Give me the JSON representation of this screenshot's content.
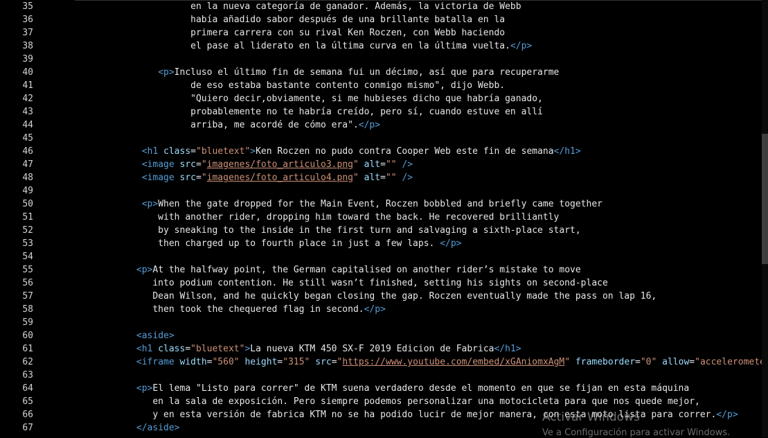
{
  "editor": {
    "first_line_number": 35,
    "lines": [
      [
        [
          "text",
          "                            en la nueva categoría de ganador. Además, la victoria de Webb"
        ]
      ],
      [
        [
          "text",
          "                            había añadido sabor después de una brillante batalla en la"
        ]
      ],
      [
        [
          "text",
          "                            primera carrera con su rival Ken Roczen, con Webb haciendo"
        ]
      ],
      [
        [
          "text",
          "                            el pase al liderato en la última curva en la última vuelta."
        ],
        [
          "tag",
          "</p>"
        ]
      ],
      [],
      [
        [
          "text",
          "                      "
        ],
        [
          "tag",
          "<p>"
        ],
        [
          "text",
          "Incluso el último fin de semana fui un décimo, así que para recuperarme"
        ]
      ],
      [
        [
          "text",
          "                            de eso estaba bastante contento conmigo mismo\", dijo Webb."
        ]
      ],
      [
        [
          "text",
          "                            \"Quiero decir,obviamente, si me hubieses dicho que habría ganado,"
        ]
      ],
      [
        [
          "text",
          "                            probablemente no te habría creído, pero sí, cuando estuve en allí"
        ]
      ],
      [
        [
          "text",
          "                            arriba, me acordé de cómo era\"."
        ],
        [
          "tag",
          "</p>"
        ]
      ],
      [],
      [
        [
          "text",
          "                   "
        ],
        [
          "tag",
          "<h1 "
        ],
        [
          "attr",
          "class"
        ],
        [
          "text",
          "="
        ],
        [
          "str",
          "\"bluetext\""
        ],
        [
          "tag",
          ">"
        ],
        [
          "text",
          "Ken Roczen no pudo contra Cooper Web este fin de semana"
        ],
        [
          "tag",
          "</h1>"
        ]
      ],
      [
        [
          "text",
          "                   "
        ],
        [
          "tag",
          "<image "
        ],
        [
          "attr",
          "src"
        ],
        [
          "text",
          "="
        ],
        [
          "str",
          "\""
        ],
        [
          "url",
          "imagenes/foto_articulo3.png"
        ],
        [
          "str",
          "\""
        ],
        [
          "text",
          " "
        ],
        [
          "attr",
          "alt"
        ],
        [
          "text",
          "="
        ],
        [
          "str",
          "\"\""
        ],
        [
          "text",
          " "
        ],
        [
          "tag",
          "/>"
        ]
      ],
      [
        [
          "text",
          "                   "
        ],
        [
          "tag",
          "<image "
        ],
        [
          "attr",
          "src"
        ],
        [
          "text",
          "="
        ],
        [
          "str",
          "\""
        ],
        [
          "url",
          "imagenes/foto_articulo4.png"
        ],
        [
          "str",
          "\""
        ],
        [
          "text",
          " "
        ],
        [
          "attr",
          "alt"
        ],
        [
          "text",
          "="
        ],
        [
          "str",
          "\"\""
        ],
        [
          "text",
          " "
        ],
        [
          "tag",
          "/>"
        ]
      ],
      [],
      [
        [
          "text",
          "                   "
        ],
        [
          "tag",
          "<p>"
        ],
        [
          "text",
          "When the gate dropped for the Main Event, Roczen bobbled and briefly came together"
        ]
      ],
      [
        [
          "text",
          "                      with another rider, dropping him toward the back. He recovered brilliantly"
        ]
      ],
      [
        [
          "text",
          "                      by sneaking to the inside in the first turn and salvaging a sixth-place start,"
        ]
      ],
      [
        [
          "text",
          "                      then charged up to fourth place in just a few laps. "
        ],
        [
          "tag",
          "</p>"
        ]
      ],
      [],
      [
        [
          "text",
          "                  "
        ],
        [
          "tag",
          "<p>"
        ],
        [
          "text",
          "At the halfway point, the German capitalised on another rider’s mistake to move"
        ]
      ],
      [
        [
          "text",
          "                     into podium contention. He still wasn’t finished, setting his sights on second-place"
        ]
      ],
      [
        [
          "text",
          "                     Dean Wilson, and he quickly began closing the gap. Roczen eventually made the pass on lap 16,"
        ]
      ],
      [
        [
          "text",
          "                     then took the chequered flag in second."
        ],
        [
          "tag",
          "</p>"
        ]
      ],
      [],
      [
        [
          "text",
          "                  "
        ],
        [
          "tag",
          "<aside>"
        ]
      ],
      [
        [
          "text",
          "                  "
        ],
        [
          "tag",
          "<h1 "
        ],
        [
          "attr",
          "class"
        ],
        [
          "text",
          "="
        ],
        [
          "str",
          "\"bluetext\""
        ],
        [
          "tag",
          ">"
        ],
        [
          "text",
          "La nueva KTM 450 SX-F 2019 Edicion de Fabrica"
        ],
        [
          "tag",
          "</h1>"
        ]
      ],
      [
        [
          "text",
          "                  "
        ],
        [
          "tag",
          "<iframe "
        ],
        [
          "attr",
          "width"
        ],
        [
          "text",
          "="
        ],
        [
          "str",
          "\"560\""
        ],
        [
          "text",
          " "
        ],
        [
          "attr",
          "height"
        ],
        [
          "text",
          "="
        ],
        [
          "str",
          "\"315\""
        ],
        [
          "text",
          " "
        ],
        [
          "attr",
          "src"
        ],
        [
          "text",
          "="
        ],
        [
          "str",
          "\""
        ],
        [
          "url",
          "https://www.youtube.com/embed/xGAniomxAgM"
        ],
        [
          "str",
          "\""
        ],
        [
          "text",
          " "
        ],
        [
          "attr",
          "frameborder"
        ],
        [
          "text",
          "="
        ],
        [
          "str",
          "\"0\""
        ],
        [
          "text",
          " "
        ],
        [
          "attr",
          "allow"
        ],
        [
          "text",
          "="
        ],
        [
          "str",
          "\"accelerometer;"
        ]
      ],
      [],
      [
        [
          "text",
          "                  "
        ],
        [
          "tag",
          "<p>"
        ],
        [
          "text",
          "El lema \"Listo para correr\" de KTM suena verdadero desde el momento en que se fijan en esta máquina"
        ]
      ],
      [
        [
          "text",
          "                     en la sala de exposición. Pero siempre podemos personalizar una motocicleta para que nos quede mejor,"
        ]
      ],
      [
        [
          "text",
          "                     y en esta versión de fabrica KTM no se ha podido lucir de mejor manera, con esta moto lista para correr."
        ],
        [
          "tag",
          "</p>"
        ]
      ],
      [
        [
          "text",
          "                  "
        ],
        [
          "tag",
          "</aside>"
        ]
      ]
    ]
  },
  "watermark": {
    "title": "Activar Windows",
    "subtitle": "Ve a Configuración para activar Windows."
  }
}
